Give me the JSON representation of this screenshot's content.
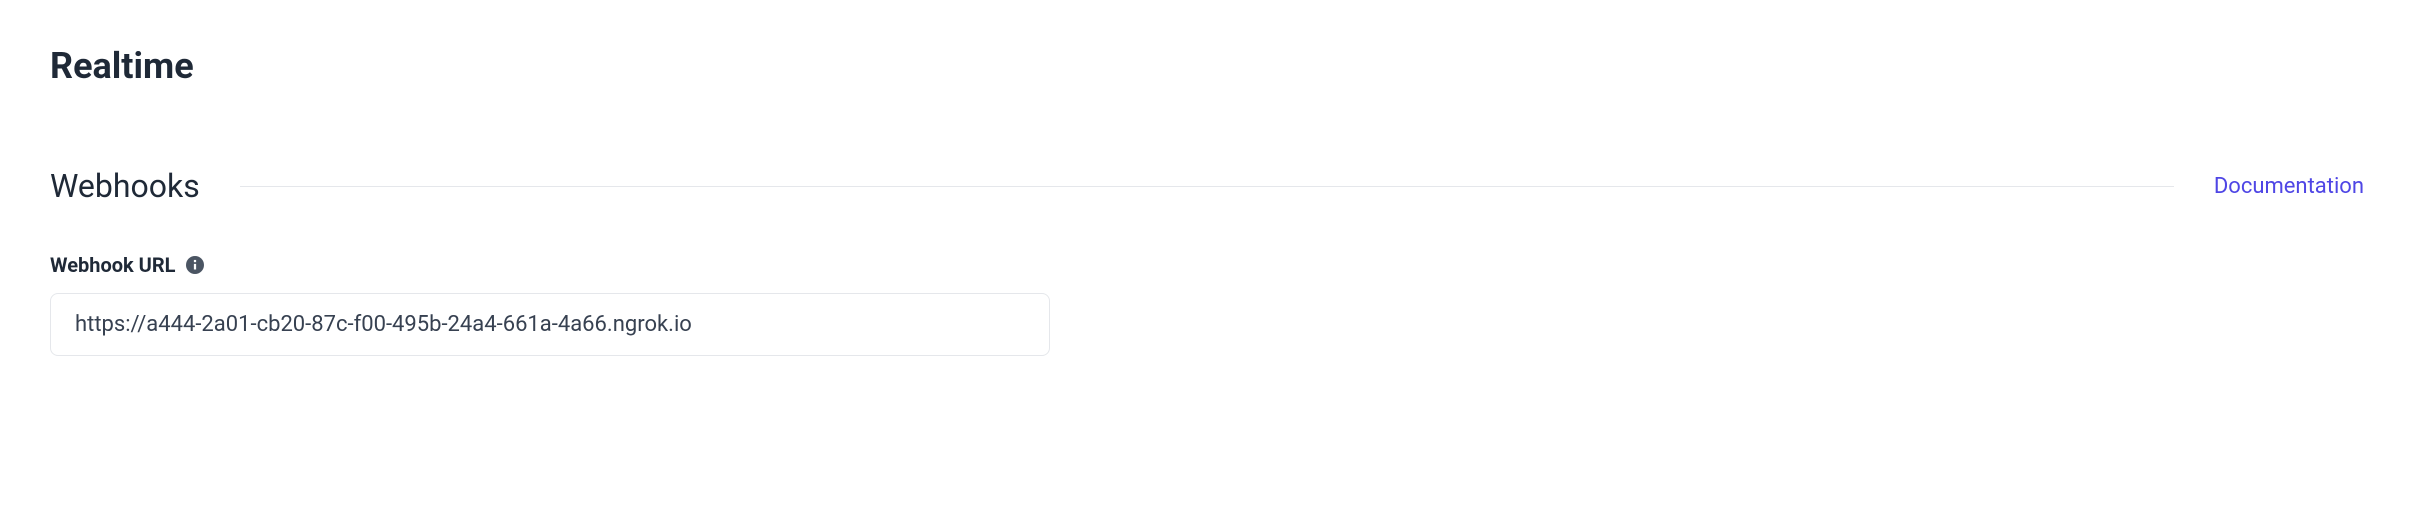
{
  "page": {
    "title": "Realtime"
  },
  "section": {
    "title": "Webhooks",
    "documentation_label": "Documentation"
  },
  "webhook": {
    "label": "Webhook URL",
    "value": "https://a444-2a01-cb20-87c-f00-495b-24a4-661a-4a66.ngrok.io"
  }
}
